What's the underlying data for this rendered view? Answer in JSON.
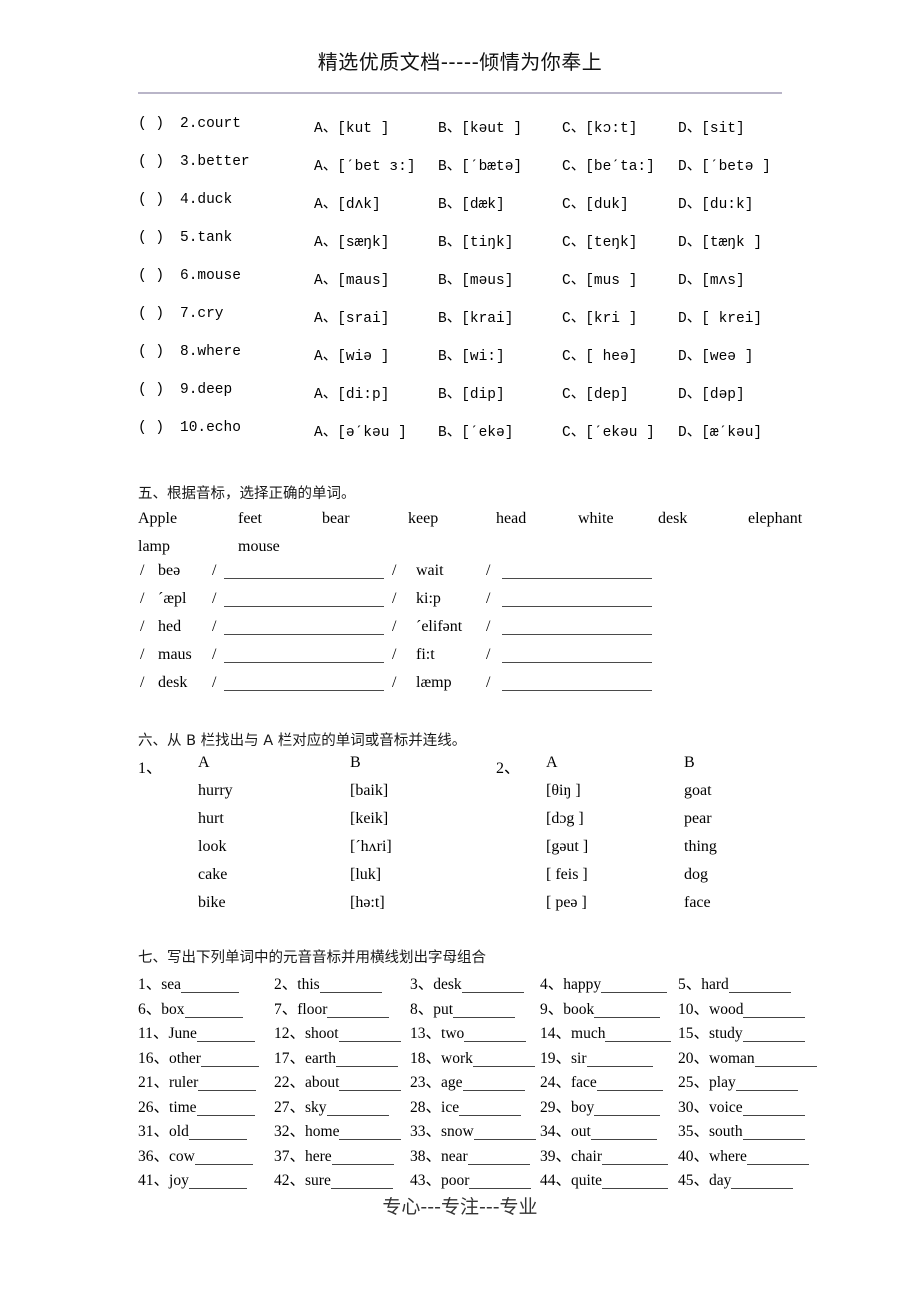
{
  "header": {
    "watermark_top": "精选优质文档-----倾情为你奉上",
    "watermark_bottom": "专心---专注---专业"
  },
  "multiple_choice": {
    "rows": [
      {
        "paren": "(    )",
        "num": "2.court",
        "a": "A、[kut ]",
        "b": "B、[kəut ]",
        "c": "C、[kɔ:t]",
        "d": "D、[sit]"
      },
      {
        "paren": "(    )",
        "num": "3.better",
        "a": "A、[ˊbet ɜ:]",
        "b": "B、[ˊbætə]",
        "c": "C、[beˊta:]",
        "d": "D、[ˊbetə ]"
      },
      {
        "paren": "(    )",
        "num": "4.duck",
        "a": "A、[dʌk]",
        "b": "B、[dæk]",
        "c": "C、[duk]",
        "d": "D、[du:k]"
      },
      {
        "paren": "(    )",
        "num": "5.tank",
        "a": "A、[sæŋk]",
        "b": "B、[tiŋk]",
        "c": "C、[teŋk]",
        "d": "D、[tæŋk ]"
      },
      {
        "paren": "(    )",
        "num": "6.mouse",
        "a": "A、[maus]",
        "b": "B、[məus]",
        "c": "C、[mus ]",
        "d": "D、[mʌs]"
      },
      {
        "paren": "(    )",
        "num": "7.cry",
        "a": "A、[srai]",
        "b": "B、[krai]",
        "c": "C、[kri ]",
        "d": "D、[ krei]"
      },
      {
        "paren": "(    )",
        "num": "8.where",
        "a": "A、[wiə ]",
        "b": "B、[wi:]",
        "c": "C、[ heə]",
        "d": "D、[weə ]"
      },
      {
        "paren": "(    )",
        "num": "9.deep",
        "a": "A、[di:p]",
        "b": "B、[dip]",
        "c": "C、[dep]",
        "d": "D、[dəp]"
      },
      {
        "paren": "(    )",
        "num": "10.echo",
        "a": "A、[əˊkəu ]",
        "b": "B、[ˊekə]",
        "c": "C、[ˊekəu ]",
        "d": "D、[æˊkəu]"
      }
    ]
  },
  "section_five": {
    "heading": "五、根据音标，选择正确的单词。",
    "word_bank_row1": [
      "Apple",
      "feet",
      "bear",
      "keep",
      "head",
      "white",
      "desk",
      "elephant"
    ],
    "word_bank_row2": [
      "lamp",
      "mouse"
    ],
    "phonetic_rows": [
      {
        "left_symbol": "beə",
        "right_symbol": "wait"
      },
      {
        "left_symbol": "ˊæpl",
        "right_symbol": "ki:p"
      },
      {
        "left_symbol": "hed",
        "right_symbol": "ˊelifənt"
      },
      {
        "left_symbol": "maus",
        "right_symbol": "fi:t"
      },
      {
        "left_symbol": "desk",
        "right_symbol": "læmp"
      }
    ],
    "slash": "/"
  },
  "section_six": {
    "heading": "六、从 B 栏找出与 A 栏对应的单词或音标并连线。",
    "group1_label": "1、",
    "group2_label": "2、",
    "col_a_label": "A",
    "col_b_label": "B",
    "group1": {
      "a": [
        "hurry",
        "hurt",
        "look",
        "cake",
        "bike"
      ],
      "b": [
        "[baik]",
        "[keik]",
        "[ˊhʌri]",
        "[luk]",
        "[hə:t]"
      ]
    },
    "group2": {
      "a": [
        "[θiŋ ]",
        "[dɔg ]",
        "[gəut ]",
        "[ feis ]",
        "[ peə ]"
      ],
      "b": [
        "goat",
        "pear",
        "thing",
        "dog",
        "face"
      ]
    }
  },
  "section_seven": {
    "heading": "七、写出下列单词中的元音音标并用横线划出字母组合",
    "rows": [
      [
        {
          "n": "1、",
          "w": "sea"
        },
        {
          "n": "2、",
          "w": "this"
        },
        {
          "n": "3、",
          "w": "desk"
        },
        {
          "n": "4、",
          "w": "happy"
        },
        {
          "n": "5、",
          "w": "hard"
        }
      ],
      [
        {
          "n": "6、",
          "w": "box"
        },
        {
          "n": "7、",
          "w": "floor"
        },
        {
          "n": "8、",
          "w": "put"
        },
        {
          "n": "9、",
          "w": "book"
        },
        {
          "n": "10、",
          "w": "wood"
        }
      ],
      [
        {
          "n": "11、",
          "w": "June"
        },
        {
          "n": "12、",
          "w": "shoot"
        },
        {
          "n": "13、",
          "w": "two"
        },
        {
          "n": "14、",
          "w": "much"
        },
        {
          "n": "15、",
          "w": "study"
        }
      ],
      [
        {
          "n": "16、",
          "w": "other"
        },
        {
          "n": "17、",
          "w": "earth"
        },
        {
          "n": "18、",
          "w": "work"
        },
        {
          "n": "19、",
          "w": "sir"
        },
        {
          "n": "20、",
          "w": "woman"
        }
      ],
      [
        {
          "n": "21、",
          "w": "ruler"
        },
        {
          "n": "22、",
          "w": "about"
        },
        {
          "n": "23、",
          "w": "age"
        },
        {
          "n": "24、",
          "w": "face"
        },
        {
          "n": "25、",
          "w": "play"
        }
      ],
      [
        {
          "n": "26、",
          "w": "time"
        },
        {
          "n": "27、",
          "w": "sky"
        },
        {
          "n": "28、",
          "w": "ice"
        },
        {
          "n": "29、",
          "w": "boy"
        },
        {
          "n": "30、",
          "w": "voice"
        }
      ],
      [
        {
          "n": "31、",
          "w": "old"
        },
        {
          "n": "32、",
          "w": "home"
        },
        {
          "n": "33、",
          "w": "snow"
        },
        {
          "n": "34、",
          "w": "out"
        },
        {
          "n": "35、",
          "w": "south"
        }
      ],
      [
        {
          "n": "36、",
          "w": "cow"
        },
        {
          "n": "37、",
          "w": "here"
        },
        {
          "n": "38、",
          "w": "near"
        },
        {
          "n": "39、",
          "w": "chair"
        },
        {
          "n": "40、",
          "w": "where"
        }
      ],
      [
        {
          "n": "41、",
          "w": "joy"
        },
        {
          "n": "42、",
          "w": "sure"
        },
        {
          "n": "43、",
          "w": "poor"
        },
        {
          "n": "44、",
          "w": "quite"
        },
        {
          "n": "45、",
          "w": "day"
        }
      ]
    ]
  }
}
